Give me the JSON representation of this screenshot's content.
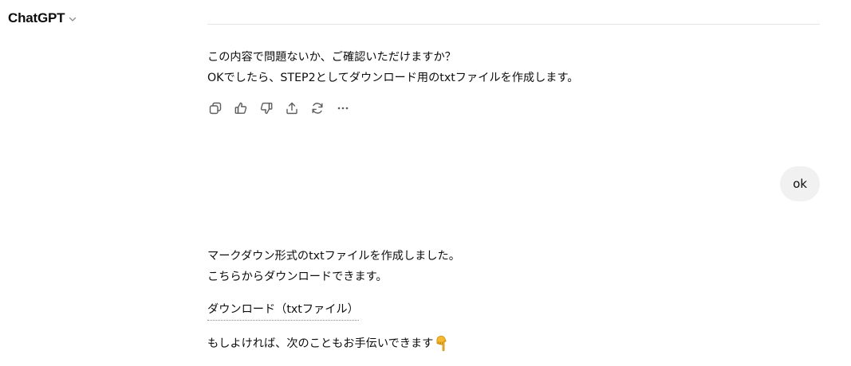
{
  "header": {
    "model_name": "ChatGPT",
    "model_switcher_icon": "chevron-down-icon"
  },
  "assistant_message_1": {
    "lines": [
      "この内容で問題ないか、ご確認いただけますか？",
      "OKでしたら、STEP2としてダウンロード用のtxtファイルを作成します。"
    ]
  },
  "message_actions": [
    {
      "icon": "copy-icon"
    },
    {
      "icon": "thumbs-up-icon"
    },
    {
      "icon": "thumbs-down-icon"
    },
    {
      "icon": "share-icon"
    },
    {
      "icon": "regenerate-icon"
    },
    {
      "icon": "more-icon"
    }
  ],
  "user_message": {
    "text": "ok"
  },
  "assistant_message_2": {
    "lines": [
      "マークダウン形式のtxtファイルを作成しました。",
      "こちらからダウンロードできます。"
    ],
    "download_link": "ダウンロード（txtファイル）",
    "closing_text": "もしよければ、次のこともお手伝いできます",
    "closing_emoji": "pointing-down-hand-icon"
  },
  "colors": {
    "text": "#0d0d0d",
    "user_bubble": "#f1f1f1",
    "divider": "#e5e5e5",
    "icon": "#5d5d5d",
    "emoji_hand": "#f5b82e"
  }
}
